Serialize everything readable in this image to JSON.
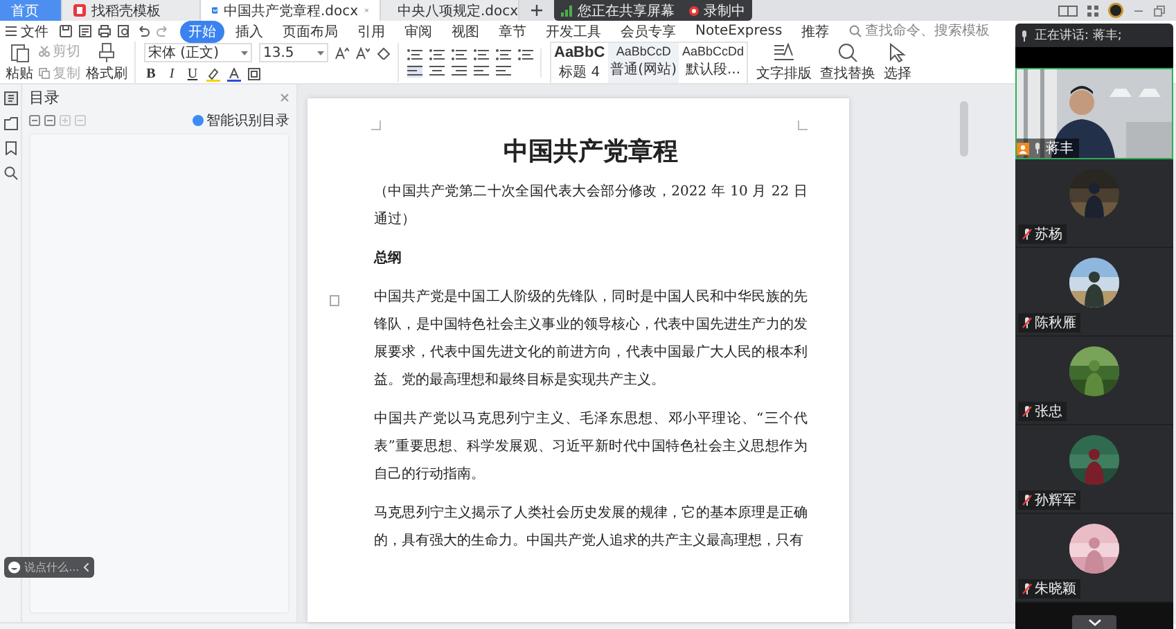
{
  "tabs": [
    {
      "label": "首页",
      "kind": "home",
      "selected": false
    },
    {
      "label": "找稻壳模板",
      "kind": "docer",
      "selected": false
    },
    {
      "label": "中国共产党章程.docx",
      "kind": "doc",
      "selected": true
    },
    {
      "label": "中央八项规定.docx",
      "kind": "doc",
      "selected": false
    }
  ],
  "sharing": {
    "label": "您正在共享屏幕",
    "recording": "录制中"
  },
  "menu": {
    "file": "文件",
    "items": [
      {
        "label": "开始",
        "selected": true
      },
      {
        "label": "插入",
        "selected": false
      },
      {
        "label": "页面布局",
        "selected": false
      },
      {
        "label": "引用",
        "selected": false
      },
      {
        "label": "审阅",
        "selected": false
      },
      {
        "label": "视图",
        "selected": false
      },
      {
        "label": "章节",
        "selected": false
      },
      {
        "label": "开发工具",
        "selected": false
      },
      {
        "label": "会员专享",
        "selected": false
      },
      {
        "label": "NoteExpress",
        "selected": false
      },
      {
        "label": "推荐",
        "selected": false
      }
    ],
    "search": {
      "placeholder": "查找命令、搜索模板"
    }
  },
  "ribbon": {
    "paste": "粘贴",
    "cut": "剪切",
    "copy": "复制",
    "format_painter": "格式刷",
    "font": "宋体 (正文)",
    "size": "13.5",
    "format_buttons": [
      "B",
      "I",
      "U"
    ],
    "styles": [
      {
        "sample": "AaBbC",
        "name": "标题 4",
        "selected": false
      },
      {
        "sample": "AaBbCcD",
        "name": "普通(网站)",
        "selected": true
      },
      {
        "sample": "AaBbCcDd",
        "name": "默认段...",
        "selected": false
      }
    ],
    "tools": [
      {
        "label": "文字排版",
        "kind": "layout"
      },
      {
        "label": "查找替换",
        "kind": "search"
      },
      {
        "label": "选择",
        "kind": "select"
      }
    ]
  },
  "nav": {
    "title": "目录",
    "smart_button": "智能识别目录"
  },
  "document": {
    "title": "中国共产党章程",
    "subtitle": "（中国共产党第二十次全国代表大会部分修改，2022 年 10 月 22 日通过）",
    "heading": "总纲",
    "paragraphs": [
      "中国共产党是中国工人阶级的先锋队，同时是中国人民和中华民族的先锋队，是中国特色社会主义事业的领导核心，代表中国先进生产力的发展要求，代表中国先进文化的前进方向，代表中国最广大人民的根本利益。党的最高理想和最终目标是实现共产主义。",
      "中国共产党以马克思列宁主义、毛泽东思想、邓小平理论、“三个代表”重要思想、科学发展观、习近平新时代中国特色社会主义思想作为自己的行动指南。",
      "马克思列宁主义揭示了人类社会历史发展的规律，它的基本原理是正确的，具有强大的生命力。中国共产党人追求的共产主义最高理想，只有"
    ]
  },
  "meeting": {
    "speaking": "正在讲话: 蒋丰;",
    "presenter": {
      "name": "蒋丰",
      "muted": false
    },
    "participants": [
      {
        "name": "苏杨",
        "muted": true
      },
      {
        "name": "陈秋雁",
        "muted": true
      },
      {
        "name": "张忠",
        "muted": true
      },
      {
        "name": "孙辉军",
        "muted": true
      },
      {
        "name": "朱晓颖",
        "muted": true
      }
    ]
  },
  "assistant": {
    "placeholder": "说点什么..."
  }
}
